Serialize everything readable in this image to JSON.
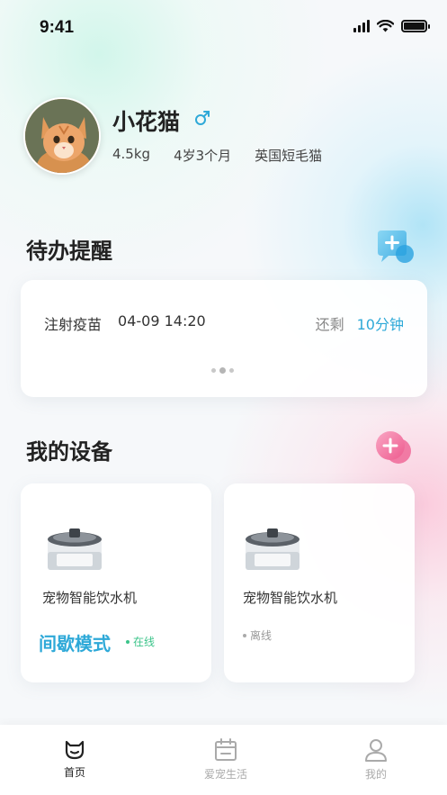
{
  "status_bar": {
    "time": "9:41"
  },
  "pet": {
    "name": "小花猫",
    "gender_symbol": "♂",
    "weight": "4.5kg",
    "age": "4岁3个月",
    "breed": "英国短毛猫"
  },
  "todo": {
    "section_title": "待办提醒",
    "item": {
      "name": "注射疫苗",
      "datetime": "04-09 14:20",
      "remain_label": "还剩",
      "remain_value": "10分钟"
    }
  },
  "devices": {
    "section_title": "我的设备",
    "items": [
      {
        "name": "宠物智能饮水机",
        "mode": "间歇模式",
        "status": "在线",
        "status_color": "#3cc48a"
      },
      {
        "name": "宠物智能饮水机",
        "mode": "",
        "status": "离线",
        "status_color": "#999999"
      }
    ]
  },
  "tabbar": {
    "items": [
      {
        "label": "首页",
        "icon": "pet-home-icon",
        "active": true
      },
      {
        "label": "爱宠生活",
        "icon": "calendar-icon",
        "active": false
      },
      {
        "label": "我的",
        "icon": "user-icon",
        "active": false
      }
    ]
  },
  "colors": {
    "accent": "#2ea9d8",
    "online": "#3cc48a",
    "pink": "#f06a9a",
    "tab_active": "#222222",
    "tab_inactive": "#aaaaaa"
  }
}
